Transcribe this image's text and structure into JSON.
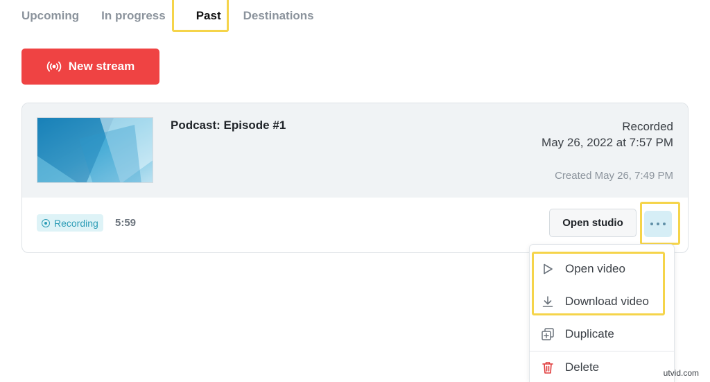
{
  "tabs": [
    {
      "label": "Upcoming"
    },
    {
      "label": "In progress"
    },
    {
      "label": "Past"
    },
    {
      "label": "Destinations"
    }
  ],
  "active_tab": "Past",
  "new_stream_button": {
    "label": "New stream",
    "icon": "broadcast-icon"
  },
  "stream": {
    "title": "Podcast: Episode #1",
    "status_label": "Recorded",
    "recorded_at": "May 26, 2022 at 7:57 PM",
    "created": "Created May 26, 7:49 PM",
    "badge": "Recording",
    "duration": "5:59",
    "open_studio_label": "Open studio",
    "more_icon": "ellipsis-icon"
  },
  "menu": {
    "items": [
      {
        "label": "Open video",
        "icon": "play-icon"
      },
      {
        "label": "Download video",
        "icon": "download-icon"
      },
      {
        "label": "Duplicate",
        "icon": "duplicate-icon"
      },
      {
        "label": "Delete",
        "icon": "trash-icon"
      }
    ]
  },
  "watermark": "utvid.com",
  "colors": {
    "accent_red": "#ef4343",
    "highlight_yellow": "#f5d44a",
    "badge_blue": "#2a9bb5",
    "delete_red": "#e03c3c"
  }
}
